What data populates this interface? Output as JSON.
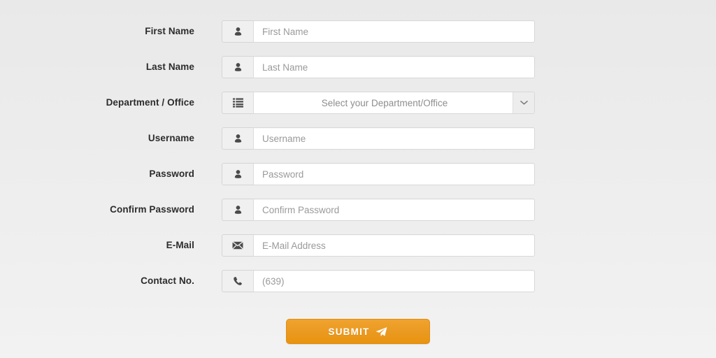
{
  "form": {
    "rows": [
      {
        "label": "First Name",
        "icon": "user-icon",
        "type": "text",
        "placeholder": "First Name",
        "value": "",
        "name": "first-name"
      },
      {
        "label": "Last Name",
        "icon": "user-icon",
        "type": "text",
        "placeholder": "Last Name",
        "value": "",
        "name": "last-name"
      },
      {
        "label": "Department / Office",
        "icon": "list-icon",
        "type": "select",
        "placeholder": "Select your Department/Office",
        "selected": "Select your Department/Office",
        "name": "department-office"
      },
      {
        "label": "Username",
        "icon": "user-icon",
        "type": "text",
        "placeholder": "Username",
        "value": "",
        "name": "username"
      },
      {
        "label": "Password",
        "icon": "user-icon",
        "type": "password",
        "placeholder": "Password",
        "value": "",
        "name": "password"
      },
      {
        "label": "Confirm Password",
        "icon": "user-icon",
        "type": "password",
        "placeholder": "Confirm Password",
        "value": "",
        "name": "confirm-password"
      },
      {
        "label": "E-Mail",
        "icon": "envelope-icon",
        "type": "email",
        "placeholder": "E-Mail Address",
        "value": "",
        "name": "email"
      },
      {
        "label": "Contact No.",
        "icon": "phone-icon",
        "type": "tel",
        "placeholder": "(639)",
        "value": "",
        "name": "contact-no"
      }
    ],
    "submit": {
      "label": "SUBMIT",
      "icon": "paper-plane-icon"
    }
  },
  "colors": {
    "page_background": "#ececec",
    "label_text": "#2c2c2c",
    "placeholder_text": "#9a9a9a",
    "field_background": "#ffffff",
    "field_border": "#d8d8d8",
    "addon_background": "#f0f0f0",
    "submit_orange": "#eb9a22",
    "submit_text": "#ffffff"
  }
}
